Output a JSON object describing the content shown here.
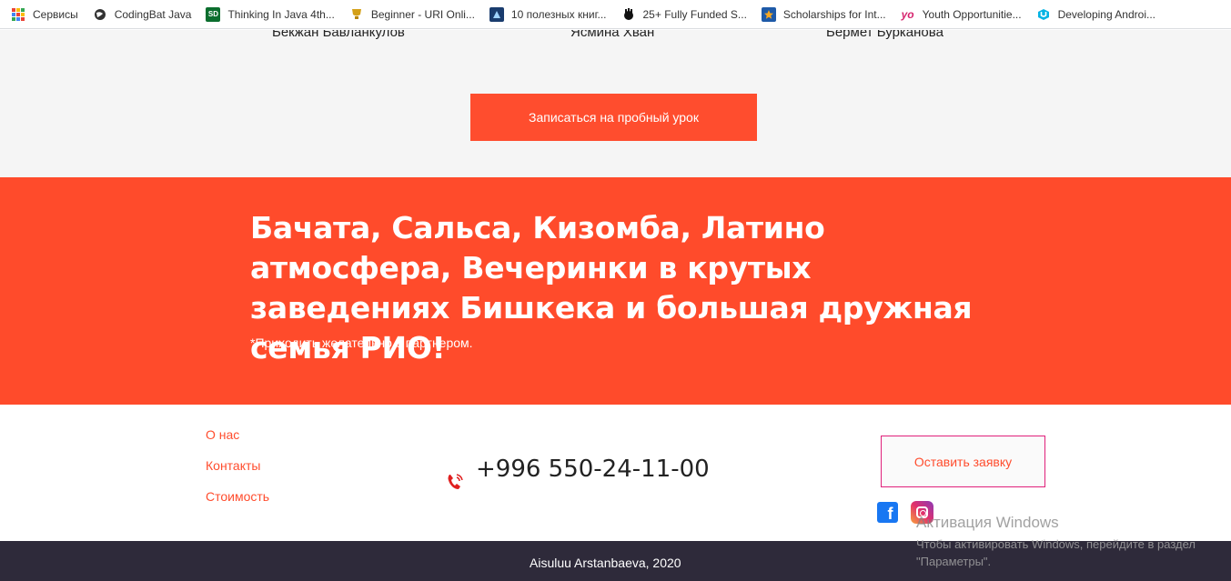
{
  "bookmarks": [
    {
      "label": "Сервисы",
      "icon": "apps-grid-icon"
    },
    {
      "label": "CodingBat Java",
      "icon": "globe-icon"
    },
    {
      "label": "Thinking In Java 4th...",
      "icon": "sd-icon"
    },
    {
      "label": "Beginner - URI Onli...",
      "icon": "trophy-icon"
    },
    {
      "label": "10 полезных книг...",
      "icon": "book-site-icon"
    },
    {
      "label": "25+ Fully Funded S...",
      "icon": "hand-icon"
    },
    {
      "label": "Scholarships for Int...",
      "icon": "star-icon"
    },
    {
      "label": "Youth Opportunitie...",
      "icon": "yo-icon"
    },
    {
      "label": "Developing Androi...",
      "icon": "udacity-icon"
    }
  ],
  "teachers": [
    "Бекжан Бавланкулов",
    "Ясмина Хван",
    "Бермет Бурканова"
  ],
  "trial_button": "Записаться на пробный урок",
  "banner": {
    "headline": "Бачата, Сальса, Кизомба, Латино атмосфера, Вечеринки в крутых заведениях Бишкека и большая дружная семья РИО!",
    "note": "*Приходить желательно с партнером."
  },
  "footer": {
    "links": [
      "О нас",
      "Контакты",
      "Стоимость"
    ],
    "phone": "+996 550-24-11-00",
    "order_button": "Оставить заявку",
    "facebook_glyph": "f"
  },
  "copyright": "Aisuluu Arstanbaeva, 2020",
  "watermark": {
    "title": "Активация Windows",
    "subtitle": "Чтобы активировать Windows, перейдите в раздел \"Параметры\"."
  },
  "colors": {
    "accent": "#ff4b2b",
    "footer_bar": "#2e2a3a",
    "order_border": "#e0207a"
  }
}
